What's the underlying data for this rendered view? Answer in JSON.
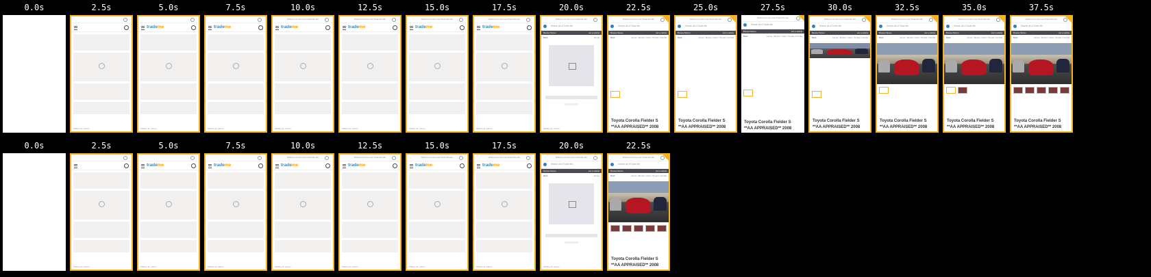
{
  "labels_row1": [
    "0.0s",
    "2.5s",
    "5.0s",
    "7.5s",
    "10.0s",
    "12.5s",
    "15.0s",
    "17.5s",
    "20.0s",
    "22.5s",
    "25.0s",
    "27.5s",
    "30.0s",
    "32.5s",
    "35.0s",
    "37.5s"
  ],
  "labels_row2": [
    "0.0s",
    "2.5s",
    "5.0s",
    "7.5s",
    "10.0s",
    "12.5s",
    "15.0s",
    "17.5s",
    "20.0s",
    "22.5s"
  ],
  "page": {
    "welcome": "Welcome to the new Trade Me site",
    "logo_a": "trade",
    "logo_b": "me",
    "loading": "Waiting for patent",
    "search_placeholder": "Search all of Trade Me",
    "browse": "Browse Motors",
    "list": "List a vehicle",
    "back": "Back",
    "crumbs": "Home / Motors / Cars / Toyota / Corolla",
    "crumbs_short": "Home",
    "title": "Toyota Corolla Fielder S",
    "subtitle": "**AA APPRAISED** 2008"
  },
  "colors": {
    "accent": "#f5b324",
    "brand_blue": "#1d93d1",
    "brand_orange": "#f4a11a",
    "car_red": "#b51621"
  }
}
